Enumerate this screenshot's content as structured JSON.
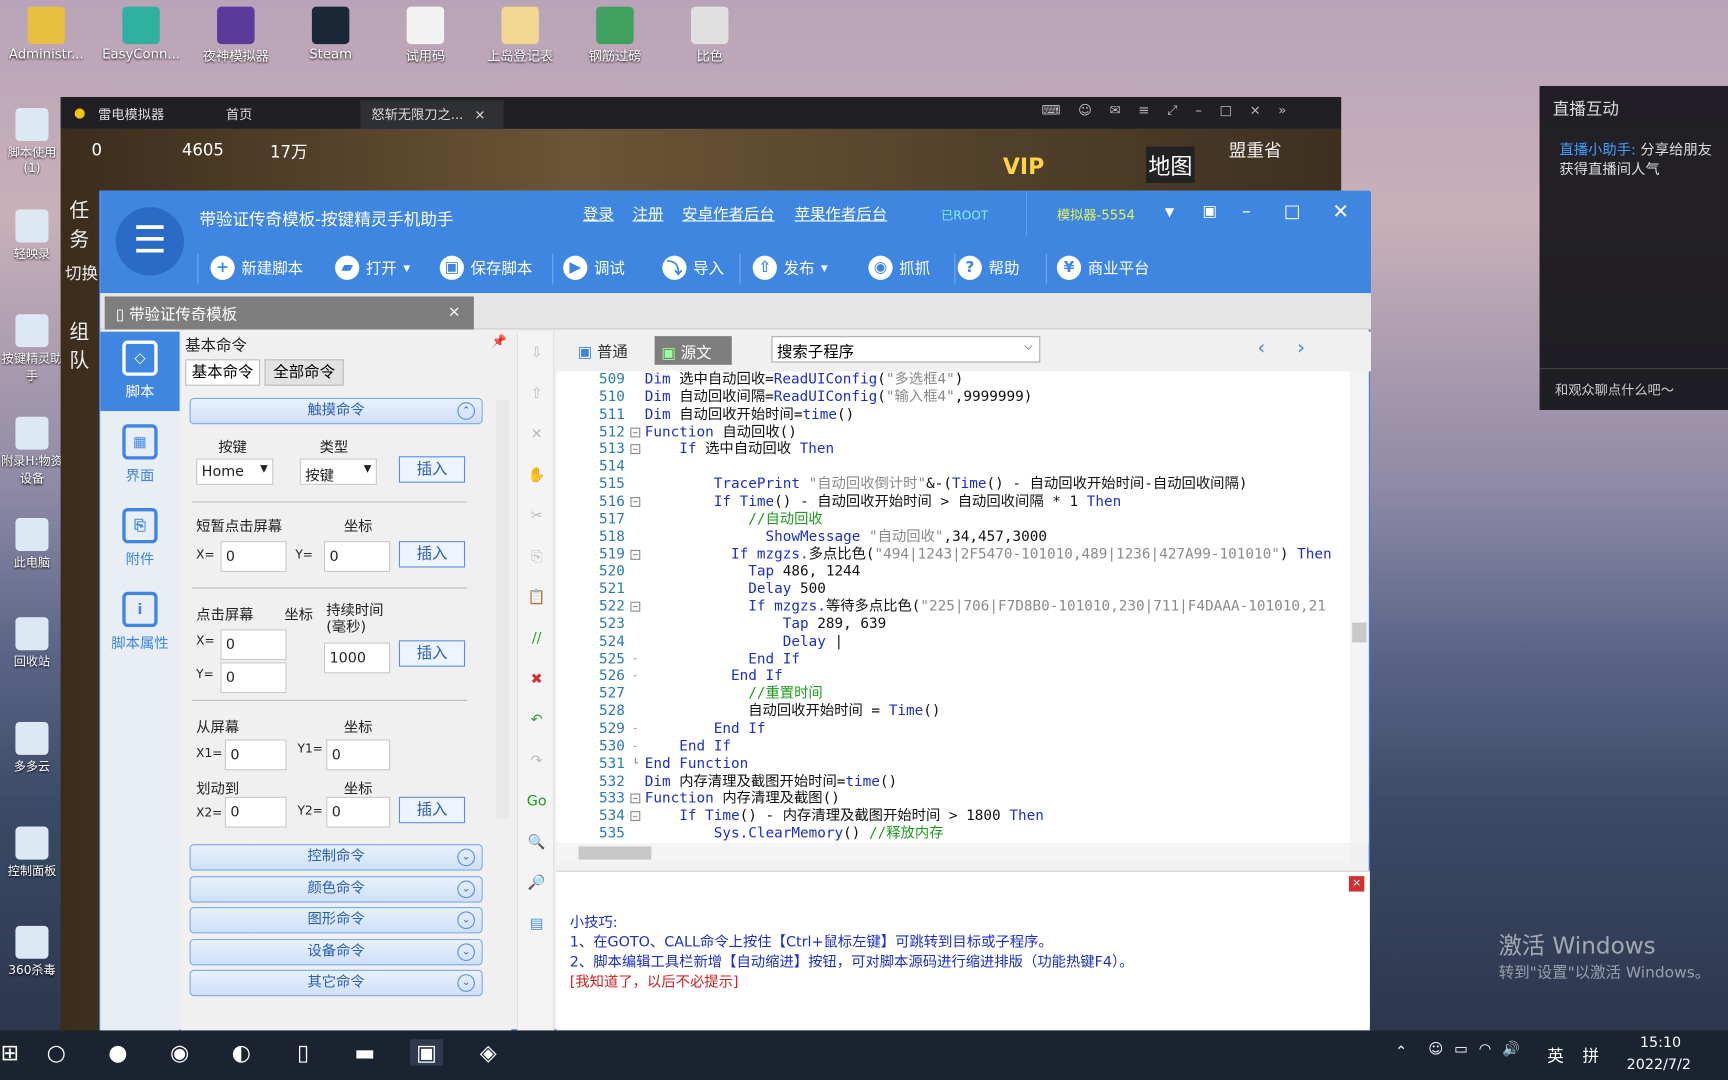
{
  "desktop": {
    "top_icons": [
      "Administr...",
      "EasyConn...",
      "夜神模拟器",
      "Steam",
      "试用码",
      "上岛登记表",
      "钢筋过磅",
      "比色"
    ],
    "left_icons": [
      "脚本使用(1)",
      "轻映录",
      "按键精灵助手",
      "附录H:物资设备",
      "此电脑",
      "回收站",
      "多多云",
      "控制面板",
      "360杀毒"
    ],
    "watermark_title": "激活 Windows",
    "watermark_sub": "转到\"设置\"以激活 Windows。"
  },
  "emulator": {
    "app_name": "雷电模拟器",
    "tab_home": "首页",
    "tab_game": "怒斩无限刀之...",
    "game_stats": [
      "0",
      "4605",
      "17万"
    ],
    "map_label": "地图",
    "location": "盟重省",
    "vip": "VIP",
    "side_labels": [
      "任务",
      "切换",
      "组队"
    ]
  },
  "live_panel": {
    "title": "直播互动",
    "assistant_name": "直播小助手:",
    "assistant_msg": "分享给朋友获得直播间人气",
    "chat_placeholder": "和观众聊点什么吧～"
  },
  "app": {
    "title": "带验证传奇模板-按键精灵手机助手",
    "links": [
      "登录",
      "注册",
      "安卓作者后台",
      "苹果作者后台"
    ],
    "root_status": "已ROOT",
    "device": "模拟器-5554",
    "toolbar": [
      {
        "label": "新建脚本",
        "icon": "plus-icon"
      },
      {
        "label": "打开",
        "icon": "folder-icon"
      },
      {
        "label": "保存脚本",
        "icon": "save-icon"
      },
      {
        "label": "调试",
        "icon": "play-icon"
      },
      {
        "label": "导入",
        "icon": "import-icon"
      },
      {
        "label": "发布",
        "icon": "publish-icon"
      },
      {
        "label": "抓抓",
        "icon": "camera-icon"
      },
      {
        "label": "帮助",
        "icon": "help-icon"
      },
      {
        "label": "商业平台",
        "icon": "money-bag-icon"
      }
    ],
    "doc_tab": "带验证传奇模板",
    "sidebar": [
      {
        "label": "脚本",
        "icon": "script-icon",
        "selected": true
      },
      {
        "label": "界面",
        "icon": "layout-icon"
      },
      {
        "label": "附件",
        "icon": "attachment-icon"
      },
      {
        "label": "脚本属性",
        "icon": "info-icon"
      }
    ],
    "cmd_panel": {
      "title": "基本命令",
      "tabs": [
        "基本命令",
        "全部命令"
      ],
      "touch_section": "触摸命令",
      "key_label": "按键",
      "type_label": "类型",
      "key_value": "Home",
      "type_value": "按键",
      "insert": "插入",
      "tap_label": "短暂点击屏幕",
      "coord_label": "坐标",
      "x_label": "X=",
      "y_label": "Y=",
      "tap_x": "0",
      "tap_y": "0",
      "press_label": "点击屏幕",
      "duration_label": "持续时间(毫秒)",
      "press_x": "0",
      "press_y": "0",
      "duration": "1000",
      "swipe_from": "从屏幕",
      "swipe_to": "划动到",
      "x1_label": "X1=",
      "y1_label": "Y1=",
      "x2_label": "X2=",
      "y2_label": "Y2=",
      "x1": "0",
      "y1": "0",
      "x2": "0",
      "y2": "0",
      "sections": [
        "控制命令",
        "颜色命令",
        "图形命令",
        "设备命令",
        "其它命令"
      ]
    },
    "editor": {
      "tabs": [
        "普通",
        "源文件"
      ],
      "active_tab": "源文件",
      "sub_search": "搜索子程序",
      "lines": [
        {
          "n": "509",
          "t": [
            [
              "Dim ",
              "k"
            ],
            [
              "选中自动回收=",
              "n"
            ],
            [
              "ReadUIConfig",
              "k"
            ],
            [
              "(",
              "n"
            ],
            [
              "\"多选框4\"",
              "s"
            ],
            [
              ")",
              "n"
            ]
          ]
        },
        {
          "n": "510",
          "t": [
            [
              "Dim ",
              "k"
            ],
            [
              "自动回收间隔=",
              "n"
            ],
            [
              "ReadUIConfig",
              "k"
            ],
            [
              "(",
              "n"
            ],
            [
              "\"输入框4\"",
              "s"
            ],
            [
              ",9999999)",
              "n"
            ]
          ]
        },
        {
          "n": "511",
          "t": [
            [
              "Dim ",
              "k"
            ],
            [
              "自动回收开始时间=",
              "n"
            ],
            [
              "time",
              "k"
            ],
            [
              "()",
              "n"
            ]
          ]
        },
        {
          "n": "512",
          "f": "-",
          "t": [
            [
              "Function ",
              "k"
            ],
            [
              "自动回收()",
              "n"
            ]
          ]
        },
        {
          "n": "513",
          "f": "-",
          "t": [
            [
              "    If ",
              "k"
            ],
            [
              "选中自动回收 ",
              "n"
            ],
            [
              "Then",
              "k"
            ]
          ]
        },
        {
          "n": "514",
          "t": []
        },
        {
          "n": "515",
          "t": [
            [
              "        TracePrint ",
              "k"
            ],
            [
              "\"自动回收倒计时\"",
              "s"
            ],
            [
              "&-(",
              "n"
            ],
            [
              "Time",
              "k"
            ],
            [
              "() - 自动回收开始时间-自动回收间隔)",
              "n"
            ]
          ]
        },
        {
          "n": "516",
          "f": "-",
          "t": [
            [
              "        If ",
              "k"
            ],
            [
              "Time",
              "k"
            ],
            [
              "() - 自动回收开始时间 > 自动回收间隔 * 1 ",
              "n"
            ],
            [
              "Then",
              "k"
            ]
          ]
        },
        {
          "n": "517",
          "t": [
            [
              "            //自动回收",
              "c"
            ]
          ]
        },
        {
          "n": "518",
          "t": [
            [
              "              ShowMessage ",
              "k"
            ],
            [
              "\"自动回收\"",
              "s"
            ],
            [
              ",34,457,3000",
              "n"
            ]
          ]
        },
        {
          "n": "519",
          "f": "-",
          "t": [
            [
              "          If ",
              "k"
            ],
            [
              "mzgzs.",
              "k"
            ],
            [
              "多点比色(",
              "n"
            ],
            [
              "\"494|1243|2F5470-101010,489|1236|427A99-101010\"",
              "s"
            ],
            [
              ") ",
              "n"
            ],
            [
              "Then",
              "k"
            ]
          ]
        },
        {
          "n": "520",
          "t": [
            [
              "            Tap ",
              "k"
            ],
            [
              "486, 1244",
              "n"
            ]
          ]
        },
        {
          "n": "521",
          "t": [
            [
              "            Delay ",
              "k"
            ],
            [
              "500",
              "n"
            ]
          ]
        },
        {
          "n": "522",
          "f": "-",
          "t": [
            [
              "            If ",
              "k"
            ],
            [
              "mzgzs.",
              "k"
            ],
            [
              "等待多点比色(",
              "n"
            ],
            [
              "\"225|706|F7D8B0-101010,230|711|F4DAAA-101010,21",
              "s"
            ]
          ]
        },
        {
          "n": "523",
          "t": [
            [
              "                Tap ",
              "k"
            ],
            [
              "289, 639",
              "n"
            ]
          ]
        },
        {
          "n": "524",
          "t": [
            [
              "                Delay ",
              "k"
            ],
            [
              "|",
              "n"
            ]
          ]
        },
        {
          "n": "525",
          "f": "l",
          "t": [
            [
              "            End If",
              "k"
            ]
          ]
        },
        {
          "n": "526",
          "f": "l",
          "t": [
            [
              "          End If",
              "k"
            ]
          ]
        },
        {
          "n": "527",
          "t": [
            [
              "            //重置时间",
              "c"
            ]
          ]
        },
        {
          "n": "528",
          "t": [
            [
              "            自动回收开始时间 = ",
              "n"
            ],
            [
              "Time",
              "k"
            ],
            [
              "()",
              "n"
            ]
          ]
        },
        {
          "n": "529",
          "f": "l",
          "t": [
            [
              "        End If",
              "k"
            ]
          ]
        },
        {
          "n": "530",
          "f": "l",
          "t": [
            [
              "    End If",
              "k"
            ]
          ]
        },
        {
          "n": "531",
          "f": "e",
          "t": [
            [
              "End Function",
              "k"
            ]
          ]
        },
        {
          "n": "532",
          "t": [
            [
              "Dim ",
              "k"
            ],
            [
              "内存清理及截图开始时间=",
              "n"
            ],
            [
              "time",
              "k"
            ],
            [
              "()",
              "n"
            ]
          ]
        },
        {
          "n": "533",
          "f": "-",
          "t": [
            [
              "Function ",
              "k"
            ],
            [
              "内存清理及截图()",
              "n"
            ]
          ]
        },
        {
          "n": "534",
          "f": "-",
          "t": [
            [
              "    If ",
              "k"
            ],
            [
              "Time",
              "k"
            ],
            [
              "() - 内存清理及截图开始时间 > 1800 ",
              "n"
            ],
            [
              "Then",
              "k"
            ]
          ]
        },
        {
          "n": "535",
          "t": [
            [
              "        Sys.ClearMemory",
              "k"
            ],
            [
              "() ",
              "n"
            ],
            [
              "//释放内存",
              "c"
            ]
          ]
        }
      ]
    },
    "tips": {
      "title": "小技巧:",
      "line1": "1、在GOTO、CALL命令上按住【Ctrl+鼠标左键】可跳转到目标或子程序。",
      "line2": "2、脚本编辑工具栏新增【自动缩进】按钮，可对脚本源码进行缩进排版（功能热键F4）。",
      "dismiss": "[我知道了，以后不必提示]"
    }
  },
  "taskbar": {
    "time": "15:10",
    "date": "2022/7/2",
    "ime_lang": "英",
    "ime_mode": "拼"
  },
  "colors": {
    "accent": "#3e86e0",
    "keyword": "#1c2fc4",
    "string": "#8a8a8a",
    "comment": "#1e9a1e",
    "tip_link": "#1c2fc4",
    "tip_dismiss": "#d02020"
  }
}
